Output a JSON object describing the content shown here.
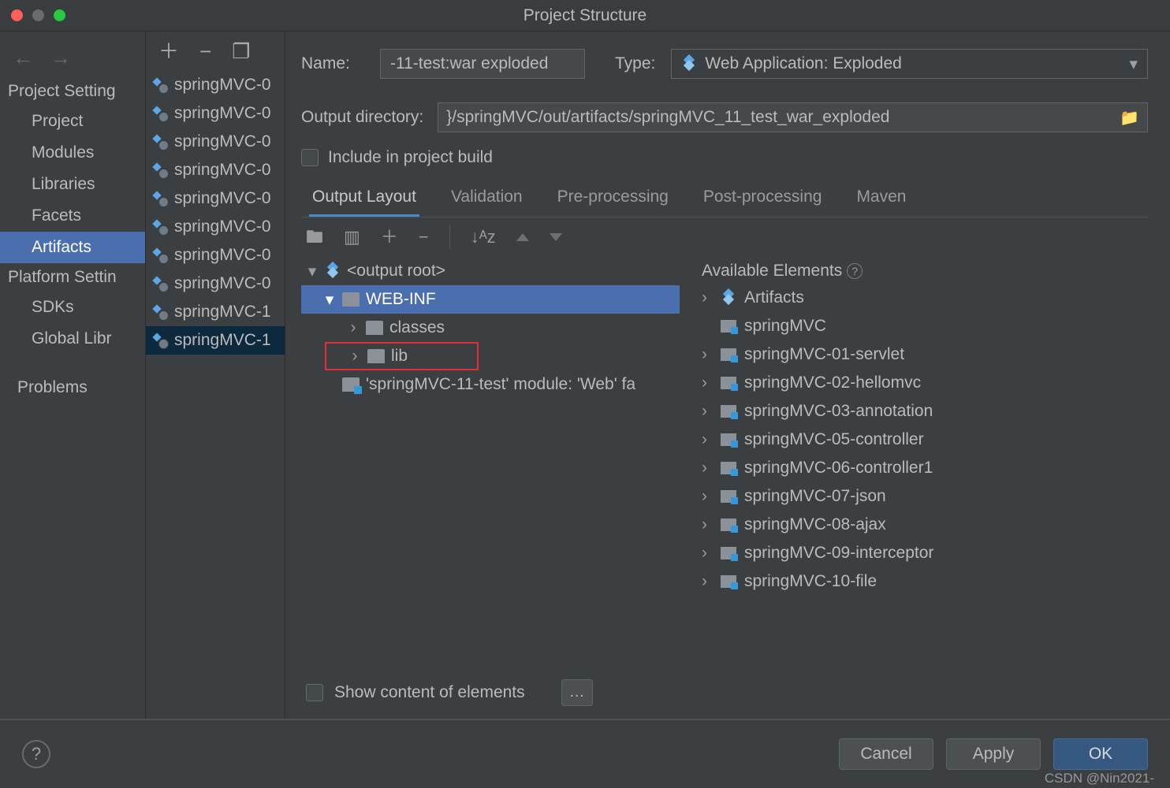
{
  "window": {
    "title": "Project Structure"
  },
  "sidebar": {
    "headers": {
      "proj": "Project Setting",
      "platform": "Platform Settin"
    },
    "items": {
      "project": "Project",
      "modules": "Modules",
      "libraries": "Libraries",
      "facets": "Facets",
      "artifacts": "Artifacts",
      "sdks": "SDKs",
      "global": "Global Libr"
    },
    "problems": "Problems"
  },
  "artifacts": {
    "items": [
      "springMVC-0",
      "springMVC-0",
      "springMVC-0",
      "springMVC-0",
      "springMVC-0",
      "springMVC-0",
      "springMVC-0",
      "springMVC-0",
      "springMVC-1",
      "springMVC-1"
    ],
    "selected_index": 9
  },
  "form": {
    "name_label": "Name:",
    "name_value": "-11-test:war exploded",
    "type_label": "Type:",
    "type_value": "Web Application: Exploded",
    "output_label": "Output directory:",
    "output_value": "}/springMVC/out/artifacts/springMVC_11_test_war_exploded",
    "include_label": "Include in project build",
    "show_content": "Show content of elements"
  },
  "tabs": {
    "output": "Output Layout",
    "validation": "Validation",
    "pre": "Pre-processing",
    "post": "Post-processing",
    "maven": "Maven"
  },
  "tree": {
    "root": "<output root>",
    "webinf": "WEB-INF",
    "classes": "classes",
    "lib": "lib",
    "module_line": "'springMVC-11-test' module: 'Web' fa"
  },
  "available": {
    "heading": "Available Elements",
    "artifacts": "Artifacts",
    "items": [
      "springMVC",
      "springMVC-01-servlet",
      "springMVC-02-hellomvc",
      "springMVC-03-annotation",
      "springMVC-05-controller",
      "springMVC-06-controller1",
      "springMVC-07-json",
      "springMVC-08-ajax",
      "springMVC-09-interceptor",
      "springMVC-10-file"
    ]
  },
  "buttons": {
    "cancel": "Cancel",
    "apply": "Apply",
    "ok": "OK"
  },
  "watermark": "CSDN @Nin2021-"
}
